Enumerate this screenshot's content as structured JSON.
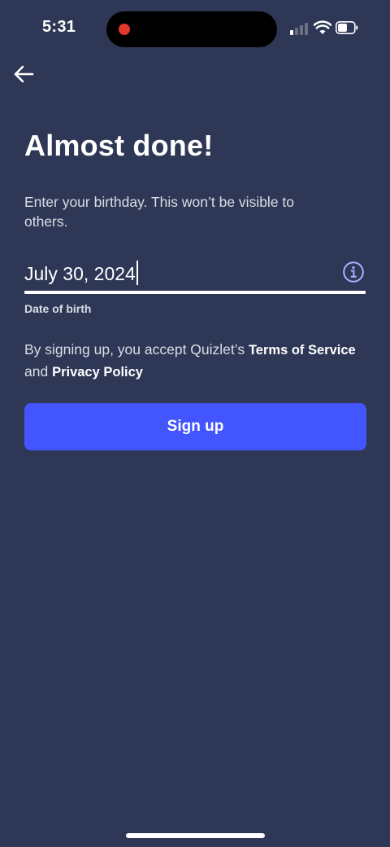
{
  "status_bar": {
    "time": "5:31",
    "recording_indicator_color": "#e0392b",
    "signal_bars_active": 1,
    "signal_bars_total": 4,
    "battery_level": 0.5,
    "icons": [
      "recording-dot-icon",
      "cellular-signal-icon",
      "wifi-icon",
      "battery-icon"
    ]
  },
  "header": {
    "back_icon": "arrow-left-icon"
  },
  "main": {
    "title": "Almost done!",
    "subtitle": "Enter your birthday. This won’t be visible to others.",
    "dob_field": {
      "value": "July 30, 2024",
      "label": "Date of birth",
      "info_icon": "info-circle-icon"
    },
    "terms": {
      "prefix": "By signing up, you accept Quizlet’s ",
      "terms_link": "Terms of Service",
      "conjunction": " and ",
      "privacy_link": "Privacy Policy"
    },
    "signup_button_label": "Sign up"
  },
  "colors": {
    "background": "#2e3856",
    "primary_button": "#4255ff",
    "text": "#ffffff",
    "info_icon": "#a8b1ff"
  }
}
